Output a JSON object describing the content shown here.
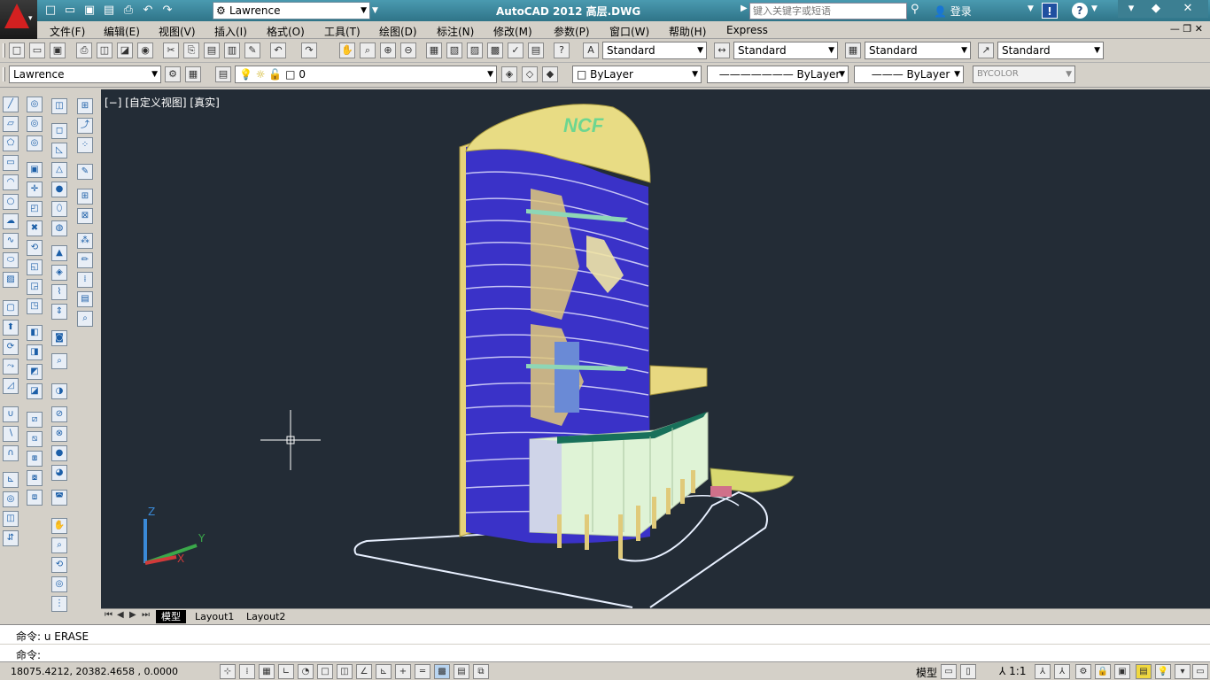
{
  "titlebar": {
    "workspace": "Lawrence",
    "title": "AutoCAD 2012   高层.DWG",
    "search_placeholder": "键入关键字或短语",
    "login": "登录"
  },
  "menu": [
    "文件(F)",
    "编辑(E)",
    "视图(V)",
    "插入(I)",
    "格式(O)",
    "工具(T)",
    "绘图(D)",
    "标注(N)",
    "修改(M)",
    "参数(P)",
    "窗口(W)",
    "帮助(H)",
    "Express"
  ],
  "styles": {
    "text": "Standard",
    "dim": "Standard",
    "table": "Standard",
    "multileader": "Standard"
  },
  "layers": {
    "workspace2": "Lawrence",
    "current_layer": "0",
    "color": "ByLayer",
    "linetype": "ByLayer",
    "lineweight": "ByLayer",
    "plotstyle": "BYCOLOR"
  },
  "viewport": {
    "label": "[−] [自定义视图] [真实]",
    "logo_text": "NCF",
    "axis_labels": {
      "x": "X",
      "y": "Y",
      "z": "Z"
    }
  },
  "tabs": [
    "模型",
    "Layout1",
    "Layout2"
  ],
  "command": {
    "line1": "命令: u ERASE",
    "line2": "命令:"
  },
  "status": {
    "coords": "18075.4212,     20382.4658 , 0.0000",
    "space": "模型",
    "scale": "1:1"
  }
}
